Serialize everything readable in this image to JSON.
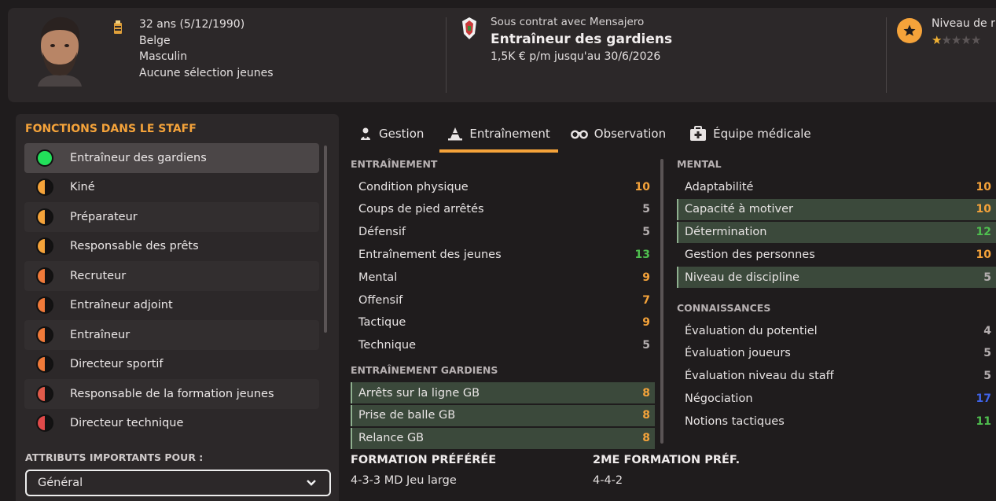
{
  "header": {
    "bio": {
      "age": "32 ans (5/12/1990)",
      "nationality": "Belge",
      "gender": "Masculin",
      "youth_caps": "Aucune sélection jeunes"
    },
    "contract": {
      "subtitle": "Sous contrat avec Mensajero",
      "role": "Entraîneur des gardiens",
      "wage": "1,5K € p/m jusqu'au 30/6/2026"
    },
    "reputation": {
      "title": "Niveau de r",
      "stars_filled": 1,
      "stars_total": 5
    }
  },
  "staff_panel": {
    "title": "FONCTIONS DANS LE STAFF",
    "items": [
      {
        "label": "Entraîneur des gardiens",
        "fill": 1.0,
        "color": "#22e05a"
      },
      {
        "label": "Kiné",
        "fill": 0.5,
        "color": "#f5a33a"
      },
      {
        "label": "Préparateur",
        "fill": 0.5,
        "color": "#f5a33a"
      },
      {
        "label": "Responsable des prêts",
        "fill": 0.5,
        "color": "#f5a33a"
      },
      {
        "label": "Recruteur",
        "fill": 0.5,
        "color": "#f07a3a"
      },
      {
        "label": "Entraîneur adjoint",
        "fill": 0.5,
        "color": "#f07a3a"
      },
      {
        "label": "Entraîneur",
        "fill": 0.5,
        "color": "#f07a3a"
      },
      {
        "label": "Directeur sportif",
        "fill": 0.5,
        "color": "#f07a3a"
      },
      {
        "label": "Responsable de la formation jeunes",
        "fill": 0.5,
        "color": "#e05a4a"
      },
      {
        "label": "Directeur technique",
        "fill": 0.5,
        "color": "#e04a4a"
      }
    ],
    "important_label": "ATTRIBUTS IMPORTANTS POUR :",
    "important_value": "Général"
  },
  "tabs": [
    {
      "label": "Gestion",
      "icon": "person-icon",
      "active": false
    },
    {
      "label": "Entraînement",
      "icon": "cone-icon",
      "active": true
    },
    {
      "label": "Observation",
      "icon": "binoculars-icon",
      "active": false
    },
    {
      "label": "Équipe médicale",
      "icon": "medical-kit-icon",
      "active": false
    }
  ],
  "sections": {
    "entrainement": {
      "title": "ENTRAÎNEMENT",
      "rows": [
        {
          "label": "Condition physique",
          "value": "10",
          "color": "orange",
          "hl": false
        },
        {
          "label": "Coups de pied arrêtés",
          "value": "5",
          "color": "grey",
          "hl": false
        },
        {
          "label": "Défensif",
          "value": "5",
          "color": "grey",
          "hl": false
        },
        {
          "label": "Entraînement des jeunes",
          "value": "13",
          "color": "green",
          "hl": false
        },
        {
          "label": "Mental",
          "value": "9",
          "color": "orange",
          "hl": false
        },
        {
          "label": "Offensif",
          "value": "7",
          "color": "orange",
          "hl": false
        },
        {
          "label": "Tactique",
          "value": "9",
          "color": "orange",
          "hl": false
        },
        {
          "label": "Technique",
          "value": "5",
          "color": "grey",
          "hl": false
        }
      ]
    },
    "gardiens": {
      "title": "ENTRAÎNEMENT GARDIENS",
      "rows": [
        {
          "label": "Arrêts sur la ligne GB",
          "value": "8",
          "color": "orange",
          "hl": true
        },
        {
          "label": "Prise de balle GB",
          "value": "8",
          "color": "orange",
          "hl": true
        },
        {
          "label": "Relance GB",
          "value": "8",
          "color": "orange",
          "hl": true
        }
      ]
    },
    "mental": {
      "title": "MENTAL",
      "rows": [
        {
          "label": "Adaptabilité",
          "value": "10",
          "color": "orange",
          "hl": false
        },
        {
          "label": "Capacité à motiver",
          "value": "10",
          "color": "orange",
          "hl": true
        },
        {
          "label": "Détermination",
          "value": "12",
          "color": "green",
          "hl": true
        },
        {
          "label": "Gestion des personnes",
          "value": "10",
          "color": "orange",
          "hl": false
        },
        {
          "label": "Niveau de discipline",
          "value": "5",
          "color": "grey",
          "hl": true
        }
      ]
    },
    "connaissances": {
      "title": "CONNAISSANCES",
      "rows": [
        {
          "label": "Évaluation du potentiel",
          "value": "4",
          "color": "grey",
          "hl": false
        },
        {
          "label": "Évaluation joueurs",
          "value": "5",
          "color": "grey",
          "hl": false
        },
        {
          "label": "Évaluation niveau du staff",
          "value": "5",
          "color": "grey",
          "hl": false
        },
        {
          "label": "Négociation",
          "value": "17",
          "color": "blue",
          "hl": false
        },
        {
          "label": "Notions tactiques",
          "value": "11",
          "color": "green",
          "hl": false
        }
      ]
    }
  },
  "formations": {
    "preferred_title": "FORMATION PRÉFÉRÉE",
    "preferred_value": "4-3-3 MD Jeu large",
    "second_title": "2ME FORMATION PRÉF.",
    "second_value": "4-4-2"
  }
}
